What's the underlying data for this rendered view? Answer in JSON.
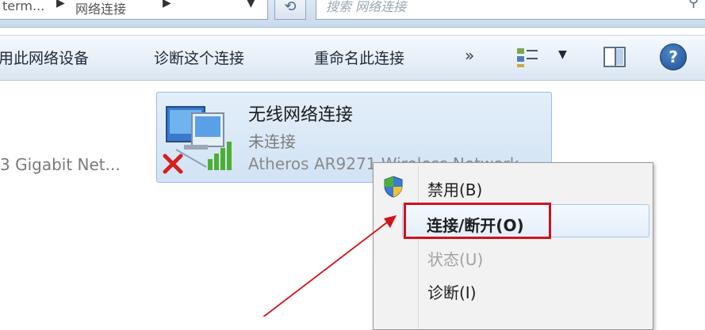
{
  "address_bar": {
    "breadcrumb_segment_1": "term...",
    "breadcrumb_segment_2": "网络连接",
    "refresh_icon": "refresh-icon",
    "search_placeholder": "搜索 网络连接",
    "search_icon": "search-icon"
  },
  "toolbar": {
    "items": [
      "用此网络设备",
      "诊断这个连接",
      "重命名此连接"
    ],
    "more_label": "»",
    "view_icon": "view-options-icon",
    "view_dropdown_icon": "chevron-down-icon",
    "pane_icon": "preview-pane-icon",
    "help_label": "?"
  },
  "connections": {
    "ethernet_label": "3 Gigabit Net...",
    "wireless": {
      "name": "无线网络连接",
      "status": "未连接",
      "adapter": "Atheros AR9271 Wireless Network",
      "icon": "wireless-network-icon",
      "error_badge": "red-x-icon"
    }
  },
  "context_menu": {
    "items": [
      {
        "label": "禁用(B)",
        "enabled": true,
        "icon": "uac-shield-icon"
      },
      {
        "label": "连接/断开(O)",
        "enabled": true,
        "highlighted": true
      },
      {
        "label": "状态(U)",
        "enabled": false
      },
      {
        "label": "诊断(I)",
        "enabled": true
      }
    ]
  },
  "annotation": {
    "highlight_color": "#d0121b",
    "arrow_color": "#d0121b"
  }
}
